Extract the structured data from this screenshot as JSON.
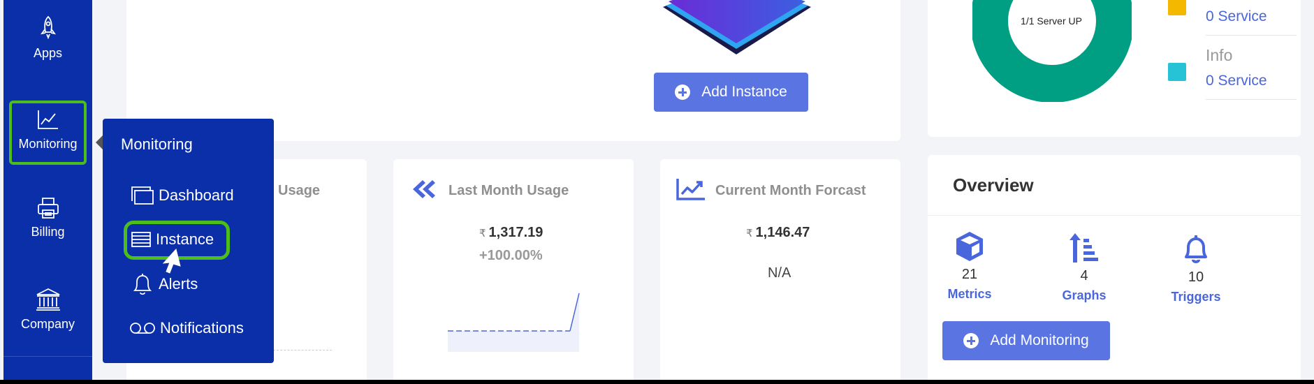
{
  "sidebar": {
    "items": [
      {
        "label": "Apps",
        "icon": "rocket-icon"
      },
      {
        "label": "Monitoring",
        "icon": "chart-icon"
      },
      {
        "label": "Billing",
        "icon": "printer-icon"
      },
      {
        "label": "Company",
        "icon": "bank-icon"
      }
    ]
  },
  "flyout": {
    "title": "Monitoring",
    "items": [
      {
        "label": "Dashboard",
        "icon": "windows-icon"
      },
      {
        "label": "Instance",
        "icon": "list-icon"
      },
      {
        "label": "Alerts",
        "icon": "bell-icon"
      },
      {
        "label": "Notifications",
        "icon": "voicemail-icon"
      }
    ]
  },
  "top_card": {
    "add_instance_label": "Add Instance"
  },
  "server_status": {
    "donut_label": "1/1 Server UP",
    "legend": [
      {
        "name": "",
        "value": "0 Service",
        "color": "#f5b800"
      },
      {
        "name": "Info",
        "value": "0 Service",
        "color": "#26c2d6"
      }
    ],
    "donut_color": "#009e82"
  },
  "usage": {
    "current_title_partial": "Usage",
    "last_month": {
      "title": "Last Month Usage",
      "currency": "₹",
      "amount": "1,317.19",
      "change": "+100.00%"
    },
    "forecast": {
      "title": "Current Month Forcast",
      "currency": "₹",
      "amount": "1,146.47",
      "na": "N/A"
    }
  },
  "overview": {
    "title": "Overview",
    "items": [
      {
        "count": "21",
        "label": "Metrics",
        "icon": "cube-icon"
      },
      {
        "count": "4",
        "label": "Graphs",
        "icon": "sort-amount-icon"
      },
      {
        "count": "10",
        "label": "Triggers",
        "icon": "bell-icon"
      }
    ],
    "add_monitoring_label": "Add Monitoring"
  },
  "colors": {
    "sidebar": "#0a2fa8",
    "accent": "#5a74e2",
    "highlight": "#4cbd1a"
  }
}
